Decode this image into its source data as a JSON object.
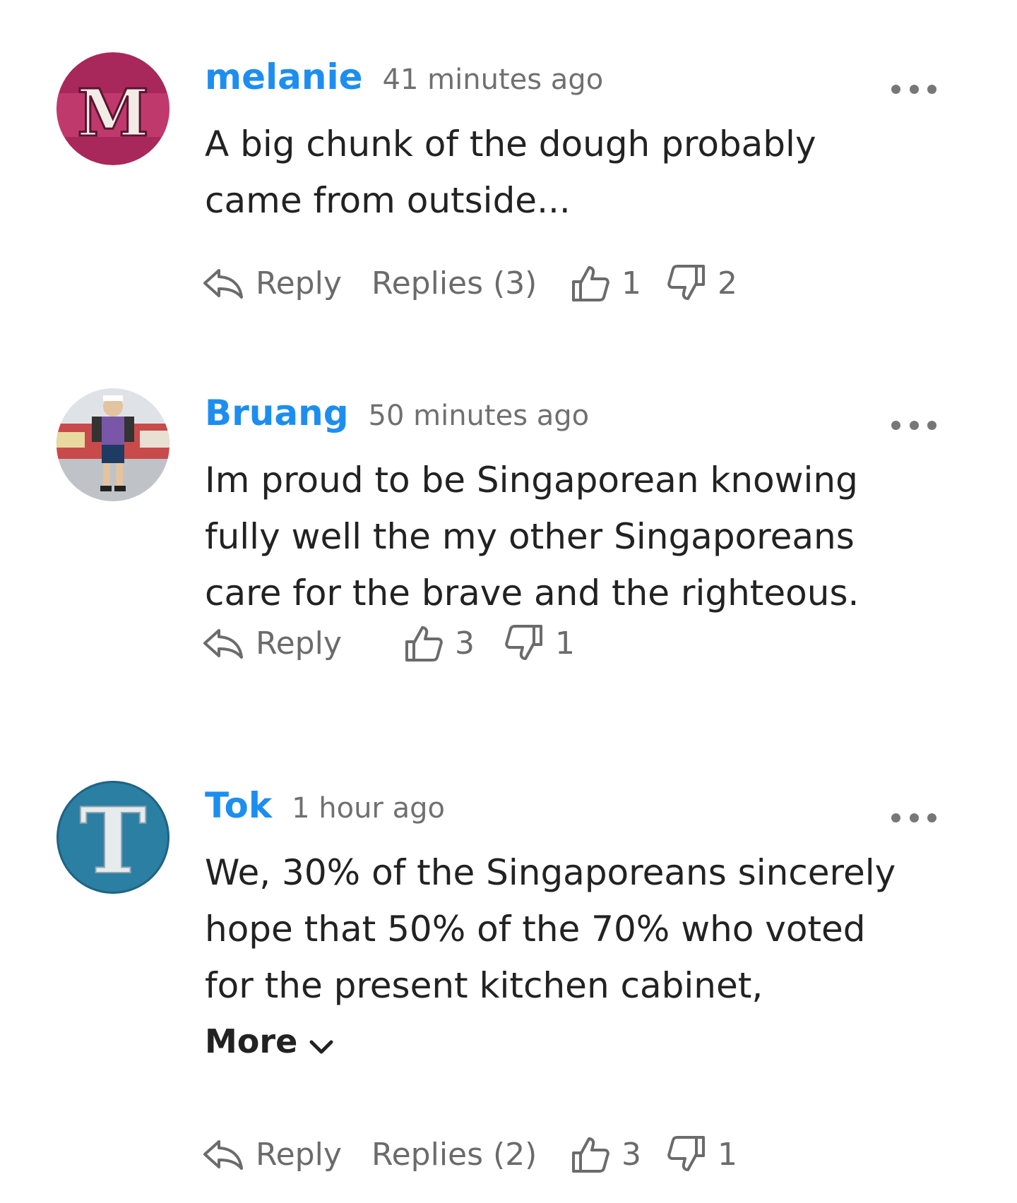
{
  "comments": [
    {
      "author": "melanie",
      "time": "41 minutes ago",
      "avatar_letter": "M",
      "avatar_color": "#a8285b",
      "lines": [
        "A big chunk of the dough probably",
        "came from outside..."
      ],
      "reply_label": "Reply",
      "replies_label": "Replies (3)",
      "likes": "1",
      "dislikes": "2"
    },
    {
      "author": "Bruang",
      "time": "50 minutes ago",
      "lines": [
        "Im proud to be Singaporean knowing",
        "fully well the my other Singaporeans",
        "care for the brave and the righteous."
      ],
      "reply_label": "Reply",
      "likes": "3",
      "dislikes": "1"
    },
    {
      "author": "Tok",
      "time": "1 hour ago",
      "avatar_letter": "T",
      "avatar_color": "#2a7fa3",
      "lines": [
        "We, 30% of the Singaporeans sincerely",
        "hope that 50% of the 70% who voted",
        "for the present kitchen cabinet,"
      ],
      "more_label": "More",
      "reply_label": "Reply",
      "replies_label": "Replies (2)",
      "likes": "3",
      "dislikes": "1"
    }
  ],
  "colors": {
    "author": "#1d8ef0",
    "meta": "#707070",
    "text": "#222222"
  },
  "icons": [
    "reply-icon",
    "thumbs-up-icon",
    "thumbs-down-icon",
    "more-options-icon",
    "chevron-down-icon"
  ]
}
